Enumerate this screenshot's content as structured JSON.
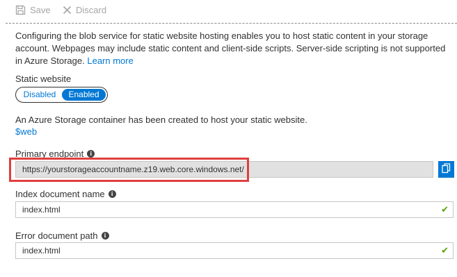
{
  "toolbar": {
    "save_label": "Save",
    "discard_label": "Discard"
  },
  "description": {
    "text": "Configuring the blob service for static website hosting enables you to host static content in your storage account. Webpages may include static content and client-side scripts. Server-side scripting is not supported in Azure Storage.",
    "link": "Learn more"
  },
  "static_website": {
    "label": "Static website",
    "options": [
      "Disabled",
      "Enabled"
    ],
    "selected": "Enabled"
  },
  "container_info": {
    "text": "An Azure Storage container has been created to host your static website.",
    "link": "$web"
  },
  "primary_endpoint": {
    "label": "Primary endpoint",
    "value": "https://yourstorageaccountname.z19.web.core.windows.net/"
  },
  "index_document": {
    "label": "Index document name",
    "value": "index.html"
  },
  "error_document": {
    "label": "Error document path",
    "value": "index.html"
  },
  "colors": {
    "accent": "#0078d4",
    "valid_check": "#57a300",
    "highlight": "#e03e3e"
  }
}
